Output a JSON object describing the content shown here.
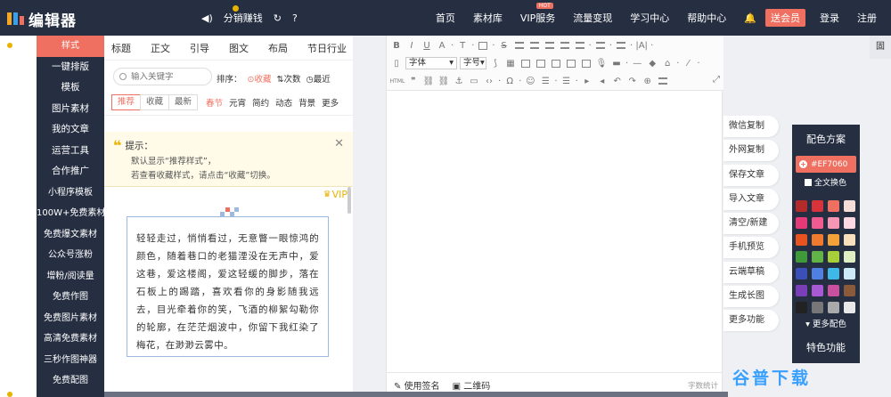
{
  "app": {
    "name": "编辑器"
  },
  "topbar": {
    "sound_icon": "volume-icon",
    "distribution": "分销赚钱",
    "refresh_icon": "refresh-icon",
    "help_icon": "help-icon",
    "nav": [
      "首页",
      "素材库",
      "VIP服务",
      "流量变现",
      "学习中心",
      "帮助中心"
    ],
    "vip_hot": "HOT",
    "bell_icon": "bell-icon",
    "send_vip": "送会员",
    "login": "登录",
    "register": "注册"
  },
  "leftnav": {
    "items": [
      "样式",
      "一键排版",
      "模板",
      "图片素材",
      "我的文章",
      "运营工具",
      "合作推广",
      "小程序模板",
      "100W+免费素材",
      "免费爆文素材",
      "公众号涨粉",
      "增粉/阅读量",
      "免费作图",
      "免费图片素材",
      "高清免费素材",
      "三秒作图神器",
      "免费配图"
    ],
    "active_index": 0
  },
  "style_panel": {
    "categories": [
      "标题",
      "正文",
      "引导",
      "图文",
      "布局",
      "节日行业"
    ],
    "search_placeholder": "输入关键字",
    "sort_label": "排序：",
    "sort_options": [
      "收藏",
      "次数",
      "最近"
    ],
    "filters": [
      "推荐",
      "收藏",
      "最新"
    ],
    "filter_active": 0,
    "tags": [
      "春节",
      "元宵",
      "简约",
      "动态",
      "背景",
      "更多"
    ],
    "tip": {
      "title": "提示：",
      "line1": "默认显示“推荐样式”，",
      "line2": "若查看收藏样式，请点击“收藏”切换。"
    },
    "vip_label": "VIP",
    "card_text": "轻轻走过，悄悄看过，无意瞥一眼惊鸿的颜色，随着巷口的老猫湮没在无声中，爱这巷，爱这楼阁，爱这轻缓的脚步，落在石板上的踢踏，喜欢看你的身影随我远去，目光牵着你的笑，飞酒的柳絮勾勒你的轮廓，在茫茫烟波中，你留下我红染了梅花，在渺渺云雾中。"
  },
  "toolbar": {
    "row1": [
      "B",
      "I",
      "U",
      "A",
      "T",
      "T",
      "S"
    ],
    "font_label": "字体",
    "size_label": "字号",
    "row3_label": "HTML",
    "omega": "Ω"
  },
  "editor": {
    "signature": "使用签名",
    "qrcode": "二维码",
    "word_count": "字数统计"
  },
  "side_buttons": [
    "微信复制",
    "外网复制",
    "保存文章",
    "导入文章",
    "清空/新建",
    "手机预览",
    "云端草稿",
    "生成长图",
    "更多功能"
  ],
  "color_panel": {
    "title": "配色方案",
    "current": "#EF7060",
    "all_label": "全文换色",
    "swatches": [
      "#b22a2a",
      "#d8333a",
      "#ef7060",
      "#f5ddd8",
      "#e53a75",
      "#f05c8f",
      "#f596b4",
      "#fbd8e2",
      "#e8531f",
      "#f07a2e",
      "#f4a13a",
      "#f8e0bc",
      "#3f9b39",
      "#62b347",
      "#a6cf3a",
      "#e0eec4",
      "#3a4fb8",
      "#4f7fe0",
      "#3fb8e8",
      "#cde8f6",
      "#7a3fb8",
      "#a85ad6",
      "#c8509e",
      "#8a5a3a",
      "#222222",
      "#777777",
      "#aaaaaa",
      "#e8e8e8"
    ],
    "more": "更多配色",
    "feature": "特色功能"
  },
  "right_strip": "固",
  "watermark": "谷普下载"
}
